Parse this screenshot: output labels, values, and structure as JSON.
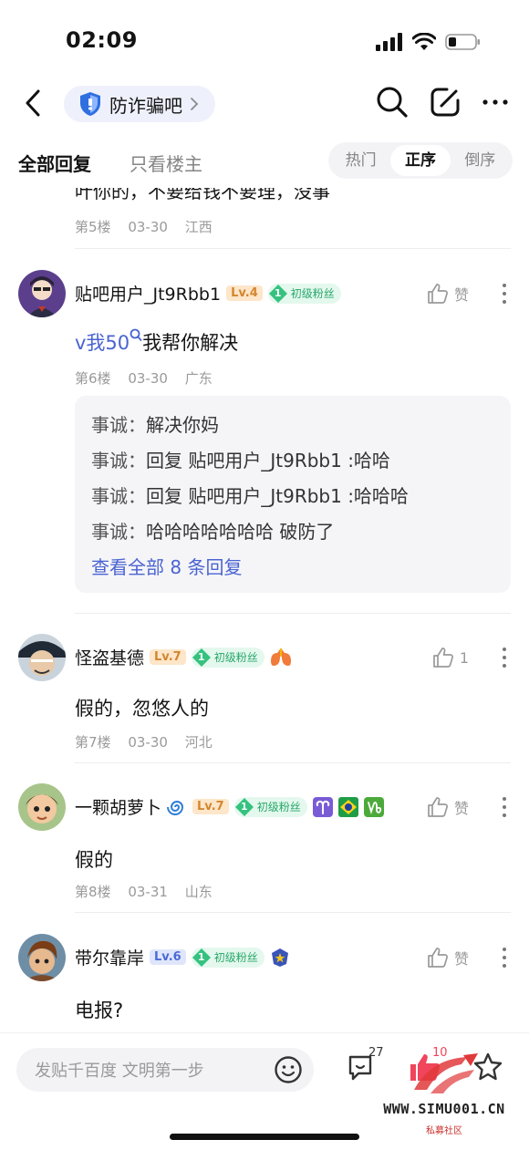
{
  "status": {
    "time": "02:09"
  },
  "nav": {
    "forum_name": "防诈骗吧"
  },
  "tabs": {
    "all": "全部回复",
    "owner": "只看楼主",
    "sort": [
      "热门",
      "正序",
      "倒序"
    ]
  },
  "prev_floor": {
    "cut_text": "叶你的，不要给钱不要理，没事",
    "floor": "第5楼",
    "date": "03-30",
    "location": "江西"
  },
  "posts": [
    {
      "username": "贴吧用户_Jt9Rbb1",
      "level": "Lv.4",
      "fan_level": "1",
      "fan_label": "初级粉丝",
      "like": "赞",
      "content_link": "v我50",
      "content_rest": "我帮你解决",
      "floor": "第6楼",
      "date": "03-30",
      "location": "广东",
      "sub_replies": [
        {
          "name": "事诚：",
          "text": "解决你妈"
        },
        {
          "name": "事诚：",
          "text": "回复 贴吧用户_Jt9Rbb1 :哈哈"
        },
        {
          "name": "事诚：",
          "text": "回复 贴吧用户_Jt9Rbb1 :哈哈哈"
        },
        {
          "name": "事诚：",
          "text": "哈哈哈哈哈哈哈 破防了"
        }
      ],
      "sub_more": "查看全部 8 条回复"
    },
    {
      "username": "怪盗基德",
      "level": "Lv.7",
      "fan_level": "1",
      "fan_label": "初级粉丝",
      "like": "1",
      "content": "假的，忽悠人的",
      "floor": "第7楼",
      "date": "03-30",
      "location": "河北"
    },
    {
      "username": "一颗胡萝卜",
      "level": "Lv.7",
      "fan_level": "1",
      "fan_label": "初级粉丝",
      "like": "赞",
      "content": "假的",
      "floor": "第8楼",
      "date": "03-31",
      "location": "山东"
    },
    {
      "username": "带尔靠岸",
      "level": "Lv.6",
      "fan_level": "1",
      "fan_label": "初级粉丝",
      "like": "赞",
      "content": "电报?"
    }
  ],
  "bottom": {
    "placeholder": "发贴千百度 文明第一步",
    "comments": "27",
    "likes": "10"
  },
  "watermark": {
    "site": "WWW.SIMU001.CN",
    "sub": "私募社区"
  },
  "colors": {
    "accent_blue": "#4a63d1",
    "fan_green": "#29a86a",
    "level_orange": "#d3862f",
    "like_red": "#f0455b"
  }
}
